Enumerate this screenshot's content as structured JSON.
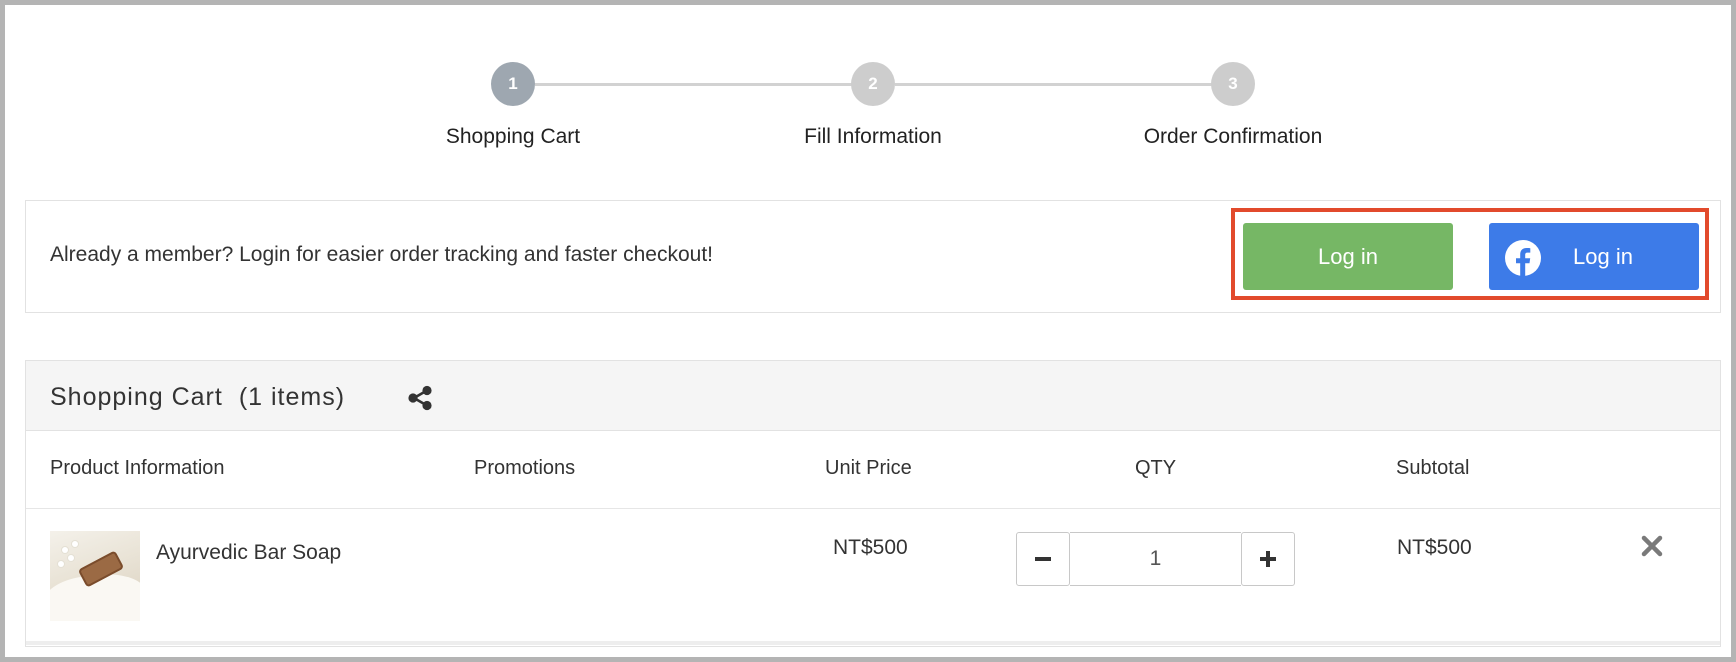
{
  "stepper": {
    "steps": [
      {
        "number": "1",
        "label": "Shopping Cart",
        "active": true
      },
      {
        "number": "2",
        "label": "Fill Information",
        "active": false
      },
      {
        "number": "3",
        "label": "Order Confirmation",
        "active": false
      }
    ]
  },
  "login_banner": {
    "message": "Already a member? Login for easier order tracking and faster checkout!",
    "login_button": "Log in",
    "facebook_login_button": "Log in",
    "highlight_color": "#e24a2c"
  },
  "cart": {
    "title": "Shopping Cart",
    "item_count": "(1 items)",
    "columns": {
      "product": "Product Information",
      "promotions": "Promotions",
      "unit_price": "Unit Price",
      "qty": "QTY",
      "subtotal": "Subtotal"
    },
    "items": [
      {
        "name": "Ayurvedic Bar Soap",
        "promotions": "",
        "unit_price": "NT$500",
        "qty": "1",
        "subtotal": "NT$500"
      }
    ]
  },
  "colors": {
    "login_green": "#76b765",
    "facebook_blue": "#3d7be8",
    "step_active": "#9ea7b0",
    "step_inactive": "#cdcdcd"
  },
  "icons": [
    "share-icon",
    "facebook-icon",
    "minus-icon",
    "plus-icon",
    "remove-icon"
  ]
}
